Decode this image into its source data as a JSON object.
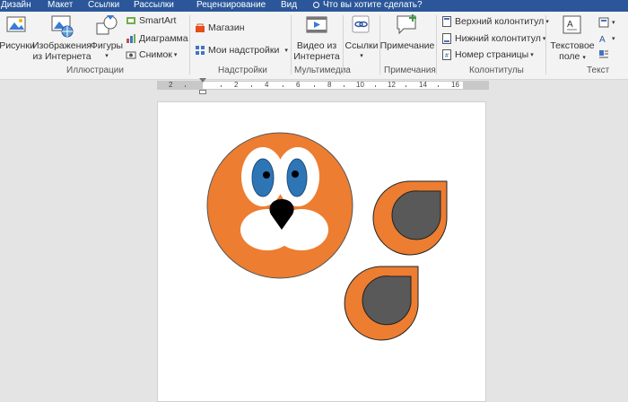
{
  "tabs": [
    "Дизайн",
    "Макет",
    "Ссылки",
    "Рассылки",
    "Рецензирование",
    "Вид"
  ],
  "tell_me": "Что вы хотите сделать?",
  "ribbon": {
    "illustrations": {
      "label": "Иллюстрации",
      "pictures": "Рисунки",
      "online_pictures_1": "Изображения",
      "online_pictures_2": "из Интернета",
      "shapes": "Фигуры",
      "smartart": "SmartArt",
      "chart": "Диаграмма",
      "screenshot": "Снимок"
    },
    "addins": {
      "label": "Надстройки",
      "store": "Магазин",
      "my_addins": "Мои надстройки"
    },
    "media": {
      "label": "Мультимедиа",
      "online_video_1": "Видео из",
      "online_video_2": "Интернета"
    },
    "links": {
      "label": "Ссылки"
    },
    "comments": {
      "label": "Примечания",
      "comment": "Примечание"
    },
    "header_footer": {
      "label": "Колонтитулы",
      "header": "Верхний колонтитул",
      "footer": "Нижний колонтитул",
      "page_number": "Номер страницы"
    },
    "text": {
      "label": "Текст",
      "textbox_1": "Текстовое",
      "textbox_2": "поле"
    }
  },
  "ruler": [
    "2",
    "2",
    "4",
    "6",
    "8",
    "10",
    "12",
    "14",
    "16"
  ],
  "colors": {
    "accent": "#2b579a",
    "face": "#ed7d31",
    "iris": "#2e75b6",
    "ear_inner": "#595959"
  }
}
